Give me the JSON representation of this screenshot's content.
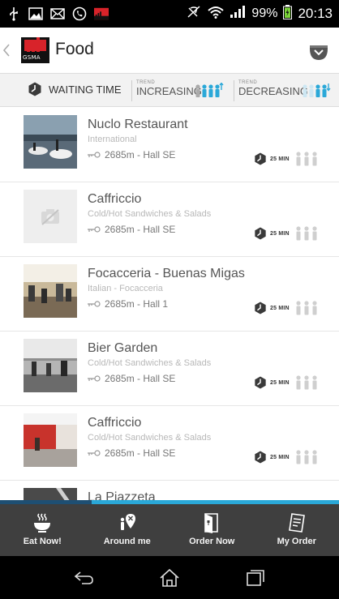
{
  "status_bar": {
    "battery": "99%",
    "time": "20:13"
  },
  "header": {
    "logo_text": "GSMA",
    "title": "Food"
  },
  "filters": {
    "waiting_time_label": "WAITING TIME",
    "increasing_small": "TREND",
    "increasing_label": "INCREASING",
    "decreasing_small": "TREND",
    "decreasing_label": "DECREASING"
  },
  "restaurants": [
    {
      "name": "Nuclo Restaurant",
      "category": "International",
      "distance": "2685m - Hall SE",
      "wait": "25 MIN",
      "image": "photo"
    },
    {
      "name": "Caffriccio",
      "category": "Cold/Hot Sandwiches & Salads",
      "distance": "2685m - Hall SE",
      "wait": "25 MIN",
      "image": "placeholder"
    },
    {
      "name": "Focacceria - Buenas Migas",
      "category": "Italian - Focacceria",
      "distance": "2685m - Hall 1",
      "wait": "25 MIN",
      "image": "photo"
    },
    {
      "name": "Bier Garden",
      "category": "Cold/Hot Sandwiches & Salads",
      "distance": "2685m - Hall SE",
      "wait": "25 MIN",
      "image": "photo"
    },
    {
      "name": "Caffriccio",
      "category": "Cold/Hot Sandwiches & Salads",
      "distance": "2685m - Hall SE",
      "wait": "25 MIN",
      "image": "photo"
    },
    {
      "name": "La Piazzeta",
      "category": "",
      "distance": "",
      "wait": "",
      "image": "photo"
    }
  ],
  "scroll_progress": 0.27,
  "bottom_nav": {
    "eat_now": "Eat Now!",
    "around_me": "Around me",
    "order_now": "Order Now",
    "my_order": "My Order"
  },
  "colors": {
    "accent_blue": "#2aa8d8",
    "nav_bg": "#3f3f3f",
    "brand_red": "#d8232a"
  }
}
